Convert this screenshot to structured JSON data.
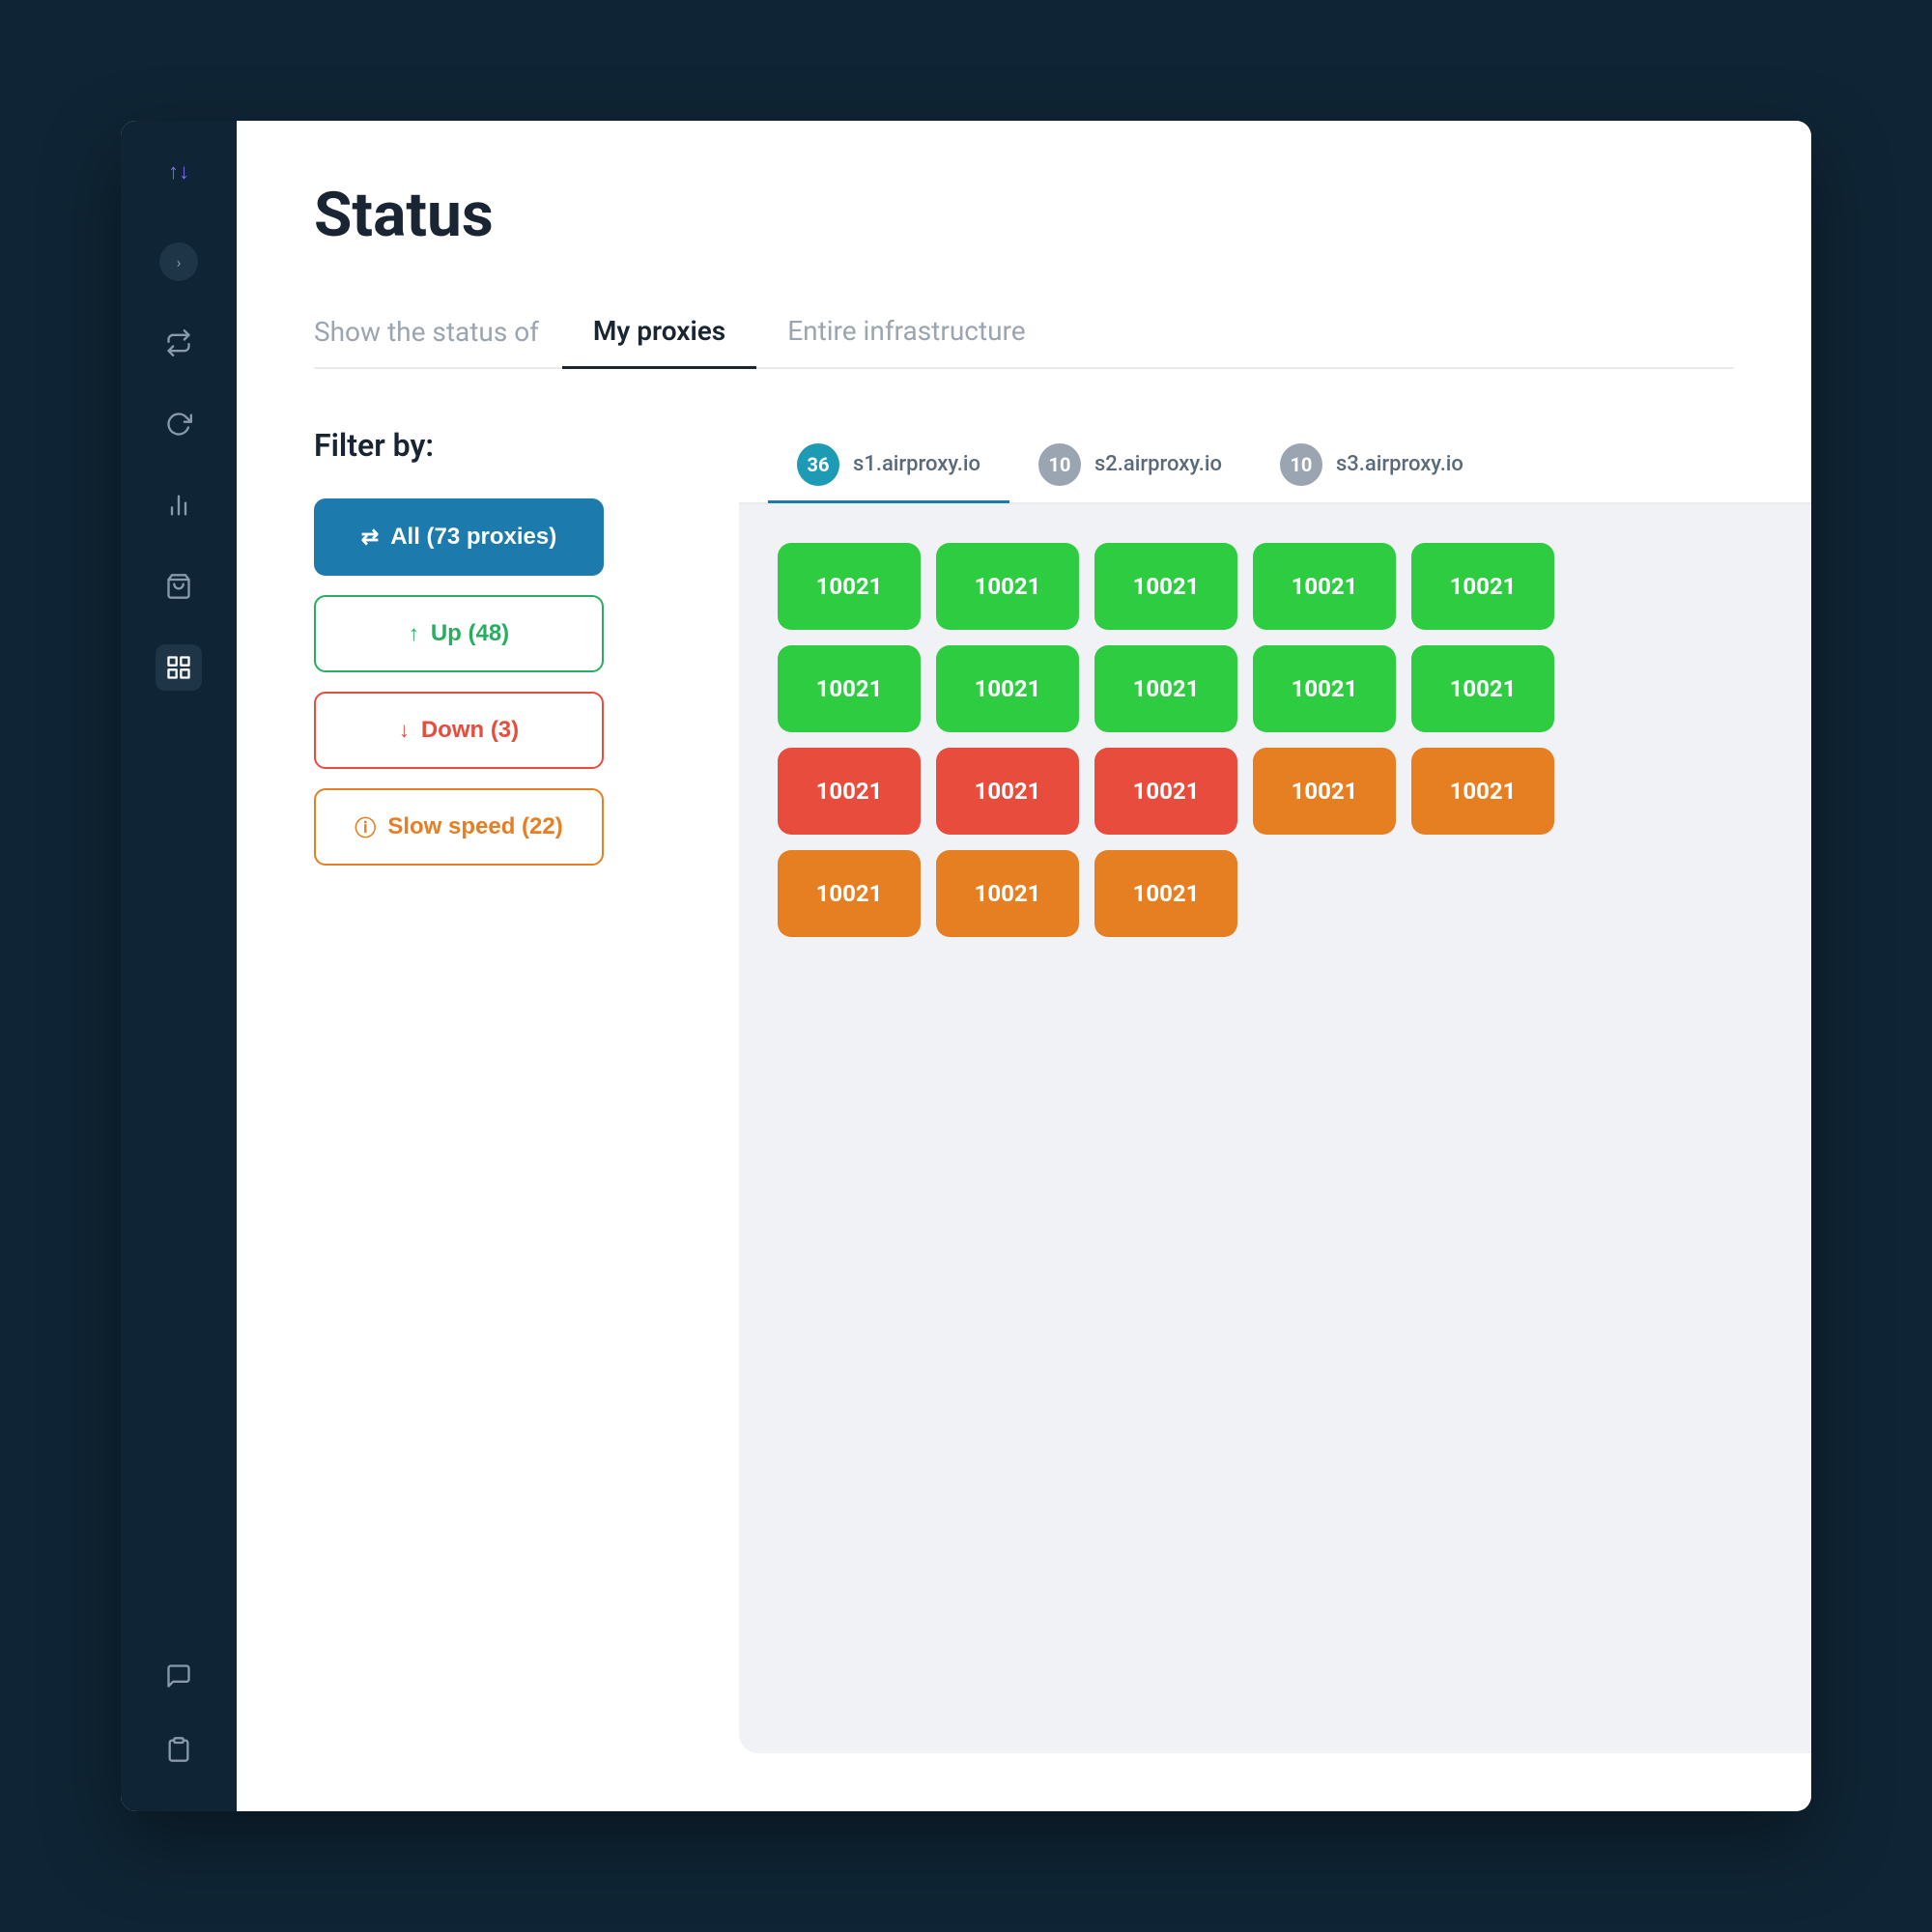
{
  "page": {
    "title": "Status"
  },
  "sidebar": {
    "logo_arrows": "↕",
    "toggle_icon": "›",
    "nav_items": [
      {
        "id": "transfer",
        "icon": "⇄",
        "active": false
      },
      {
        "id": "refresh",
        "icon": "↺",
        "active": false
      },
      {
        "id": "chart-bar",
        "icon": "▦",
        "active": false
      },
      {
        "id": "bag",
        "icon": "🛍",
        "active": false
      },
      {
        "id": "bar-chart",
        "icon": "📊",
        "active": true
      }
    ],
    "bottom_items": [
      {
        "id": "chat",
        "icon": "💬"
      },
      {
        "id": "clipboard",
        "icon": "📋"
      }
    ]
  },
  "tabs": {
    "static_label": "Show the status of",
    "items": [
      {
        "id": "my-proxies",
        "label": "My proxies",
        "active": true
      },
      {
        "id": "entire-infrastructure",
        "label": "Entire infrastructure",
        "active": false
      }
    ]
  },
  "filter": {
    "title": "Filter by:",
    "buttons": [
      {
        "id": "all",
        "icon": "⇄",
        "label": "All (73 proxies)",
        "type": "all"
      },
      {
        "id": "up",
        "icon": "↑",
        "label": "Up (48)",
        "type": "up"
      },
      {
        "id": "down",
        "icon": "↓",
        "label": "Down (3)",
        "type": "down"
      },
      {
        "id": "slow",
        "icon": "ⓘ",
        "label": "Slow speed (22)",
        "type": "slow"
      }
    ]
  },
  "proxy_tabs": [
    {
      "id": "s1",
      "badge": "36",
      "badge_style": "teal",
      "label": "s1.airproxy.io",
      "active": true
    },
    {
      "id": "s2",
      "badge": "10",
      "badge_style": "gray",
      "label": "s2.airproxy.io",
      "active": false
    },
    {
      "id": "s3",
      "badge": "10",
      "badge_style": "gray",
      "label": "s3.airproxy.io",
      "active": false
    }
  ],
  "proxy_grid": {
    "rows": [
      [
        {
          "id": "p1",
          "label": "10021",
          "color": "green"
        },
        {
          "id": "p2",
          "label": "10021",
          "color": "green"
        },
        {
          "id": "p3",
          "label": "10021",
          "color": "green"
        },
        {
          "id": "p4",
          "label": "10021",
          "color": "green"
        },
        {
          "id": "p5",
          "label": "10021",
          "color": "green"
        }
      ],
      [
        {
          "id": "p6",
          "label": "10021",
          "color": "green"
        },
        {
          "id": "p7",
          "label": "10021",
          "color": "green"
        },
        {
          "id": "p8",
          "label": "10021",
          "color": "green"
        },
        {
          "id": "p9",
          "label": "10021",
          "color": "green"
        },
        {
          "id": "p10",
          "label": "10021",
          "color": "green"
        }
      ],
      [
        {
          "id": "p11",
          "label": "10021",
          "color": "red"
        },
        {
          "id": "p12",
          "label": "10021",
          "color": "red"
        },
        {
          "id": "p13",
          "label": "10021",
          "color": "red"
        },
        {
          "id": "p14",
          "label": "10021",
          "color": "orange"
        },
        {
          "id": "p15",
          "label": "10021",
          "color": "orange"
        }
      ],
      [
        {
          "id": "p16",
          "label": "10021",
          "color": "orange"
        },
        {
          "id": "p17",
          "label": "10021",
          "color": "orange"
        },
        {
          "id": "p18",
          "label": "10021",
          "color": "orange"
        }
      ]
    ]
  }
}
